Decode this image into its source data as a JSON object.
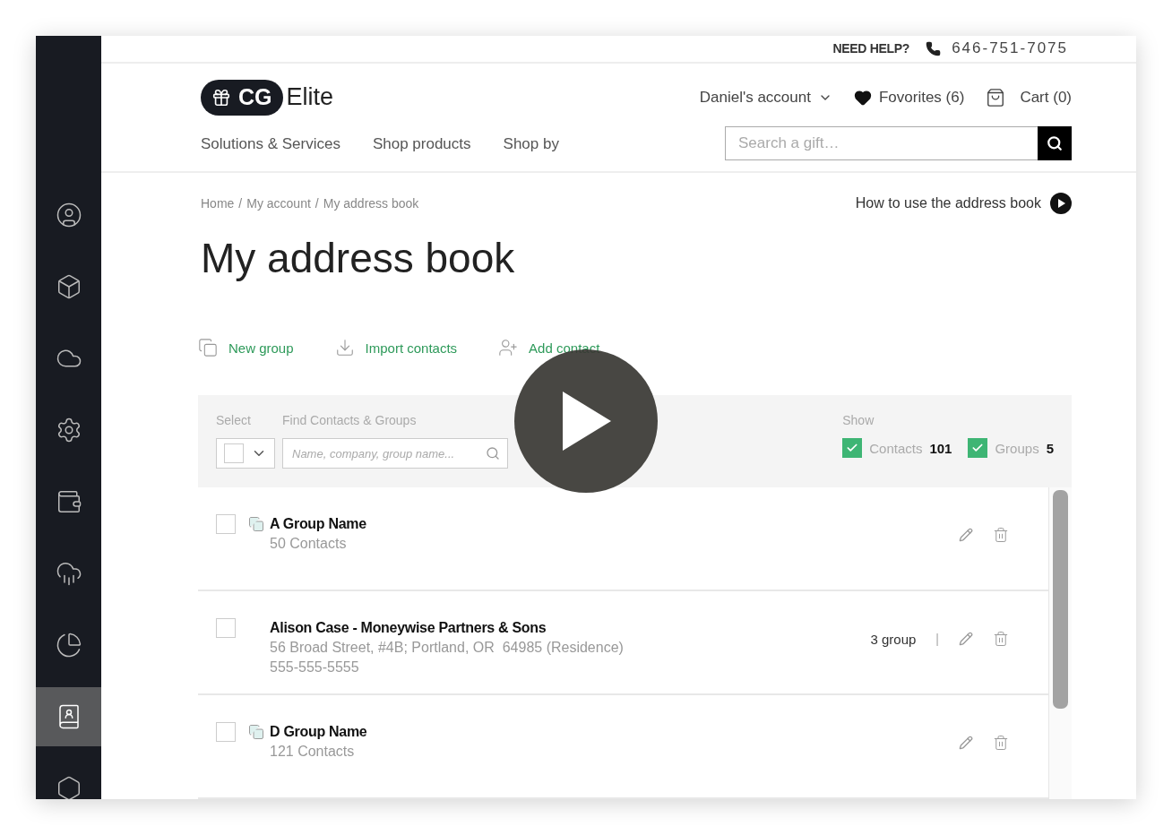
{
  "top_bar": {
    "help_label": "NEED HELP?",
    "phone": "646-751-7075"
  },
  "header": {
    "logo": {
      "badge": "CG",
      "name": "Elite"
    },
    "nav": [
      "Solutions & Services",
      "Shop products",
      "Shop by"
    ],
    "account": "Daniel's account",
    "favorites": "Fovorites (6)",
    "cart": "Cart (0)",
    "search": {
      "placeholder": "Search a gift…"
    }
  },
  "sidebar": {
    "items": [
      {
        "selected": false
      },
      {
        "selected": false
      },
      {
        "selected": false
      },
      {
        "selected": false
      },
      {
        "selected": false
      },
      {
        "selected": false
      },
      {
        "selected": false
      },
      {
        "selected": true
      },
      {
        "selected": false
      }
    ]
  },
  "breadcrumb": {
    "separator": "/",
    "items": [
      "Home",
      "My account",
      "My address book"
    ]
  },
  "help_link": "How to use the address book",
  "title": "My address book",
  "actions": [
    {
      "kind": "group",
      "label": "New group"
    },
    {
      "kind": "import",
      "label": "Import contacts"
    },
    {
      "kind": "add",
      "label": "Add contact"
    }
  ],
  "filters": {
    "select_label": "Select",
    "select_checked": false,
    "find_label": "Find Contacts & Groups",
    "find_placeholder": "Name, company, group name...",
    "show_label": "Show",
    "show": [
      {
        "label": "Contacts",
        "count": "101",
        "checked": true
      },
      {
        "label": "Groups",
        "count": "5",
        "checked": true
      }
    ]
  },
  "rows": [
    {
      "kind": "group",
      "checked": false,
      "name": "A Group Name",
      "lines": [
        "50 Contacts"
      ]
    },
    {
      "kind": "contact",
      "checked": false,
      "name": "Alison Case - Moneywise Partners & Sons",
      "lines": [
        "56 Broad Street, #4B; Portland, OR  64985 (Residence)",
        "555-555-5555"
      ],
      "groups": "3 group",
      "divider": "|"
    },
    {
      "kind": "group",
      "checked": false,
      "name": "D Group Name",
      "lines": [
        "121 Contacts"
      ]
    }
  ]
}
